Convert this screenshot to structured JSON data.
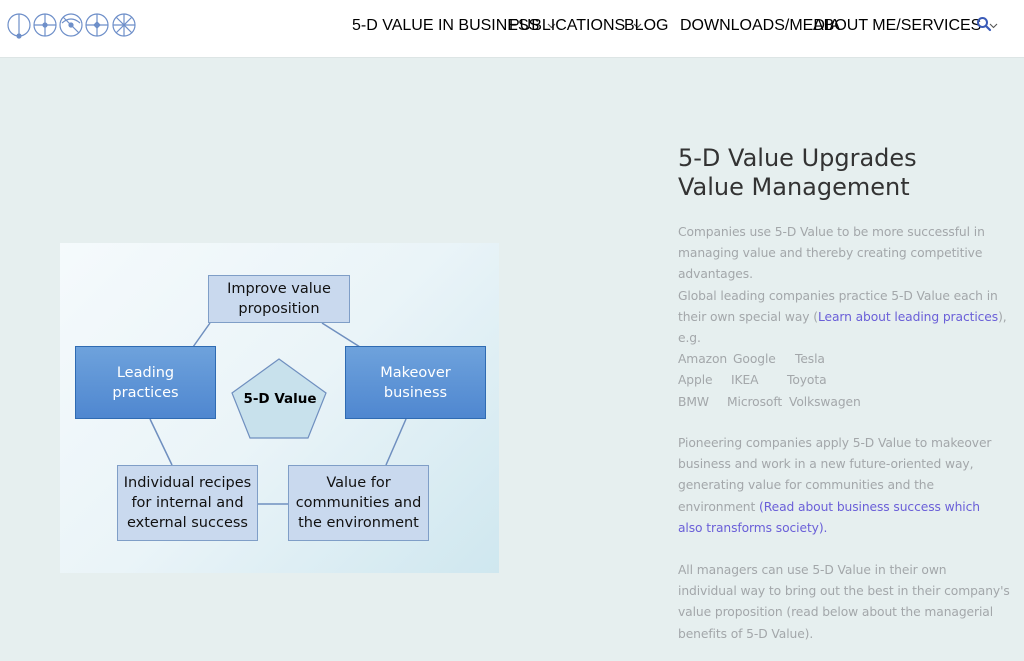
{
  "nav": {
    "items": [
      {
        "label": "5-D VALUE IN BUSINESS",
        "has_dropdown": true
      },
      {
        "label": "PUBLICATIONS",
        "has_dropdown": true
      },
      {
        "label": "BLOG",
        "has_dropdown": false
      },
      {
        "label": "DOWNLOADS/MEDIA",
        "has_dropdown": false
      },
      {
        "label": "ABOUT ME/SERVICES",
        "has_dropdown": true
      }
    ],
    "search_icon": "search-icon",
    "accent": "#3a5bb8"
  },
  "figure": {
    "top": "Improve value proposition",
    "top_l1": "Improve value",
    "top_l2": "proposition",
    "left_l1": "Leading",
    "left_l2": "practices",
    "right_l1": "Makeover",
    "right_l2": "business",
    "center": "5-D Value",
    "bl_l1": "Individual recipes",
    "bl_l2": "for internal and",
    "bl_l3": "external success",
    "br_l1": "Value for",
    "br_l2": "communities and",
    "br_l3": "the environment"
  },
  "content": {
    "title_l1": "5-D Value Upgrades",
    "title_l2": "Value Management",
    "p1_l1": "Companies use 5-D Value to be more successful in",
    "p1_l2": "managing value and thereby creating competitive",
    "p1_l3": "advantages.",
    "p1_l4": "Global leading companies practice 5-D Value each in",
    "p1_l5_pre": "their own special way (",
    "p1_l5_link": "Learn about leading practices",
    "p1_l5_post": "),",
    "p1_l6": "e.g.",
    "companies": [
      [
        "Amazon",
        "Google",
        "Tesla"
      ],
      [
        "Apple",
        "IKEA",
        "Toyota"
      ],
      [
        "BMW",
        "Microsoft",
        "Volkswagen"
      ]
    ],
    "p2_l1": "Pioneering companies apply 5-D Value to makeover",
    "p2_l2": "business and work in a new future-oriented way,",
    "p2_l3": "generating value for communities and the",
    "p2_l4_pre": "environment ",
    "p2_l4_link": "(Read about business success which",
    "p2_l5_link": "also transforms society).",
    "p3_l1": "All managers can use 5-D Value in their own",
    "p3_l2": "individual way to bring out the best in their company's",
    "p3_l3": "value proposition (read below about the managerial",
    "p3_l4": "benefits of 5-D Value)."
  },
  "colors": {
    "background": "#e6efef",
    "link": "#6a5fd8",
    "body_text": "#a3a7aa",
    "box_light": "#c9d9ee",
    "box_blue": "#4f87d0"
  }
}
